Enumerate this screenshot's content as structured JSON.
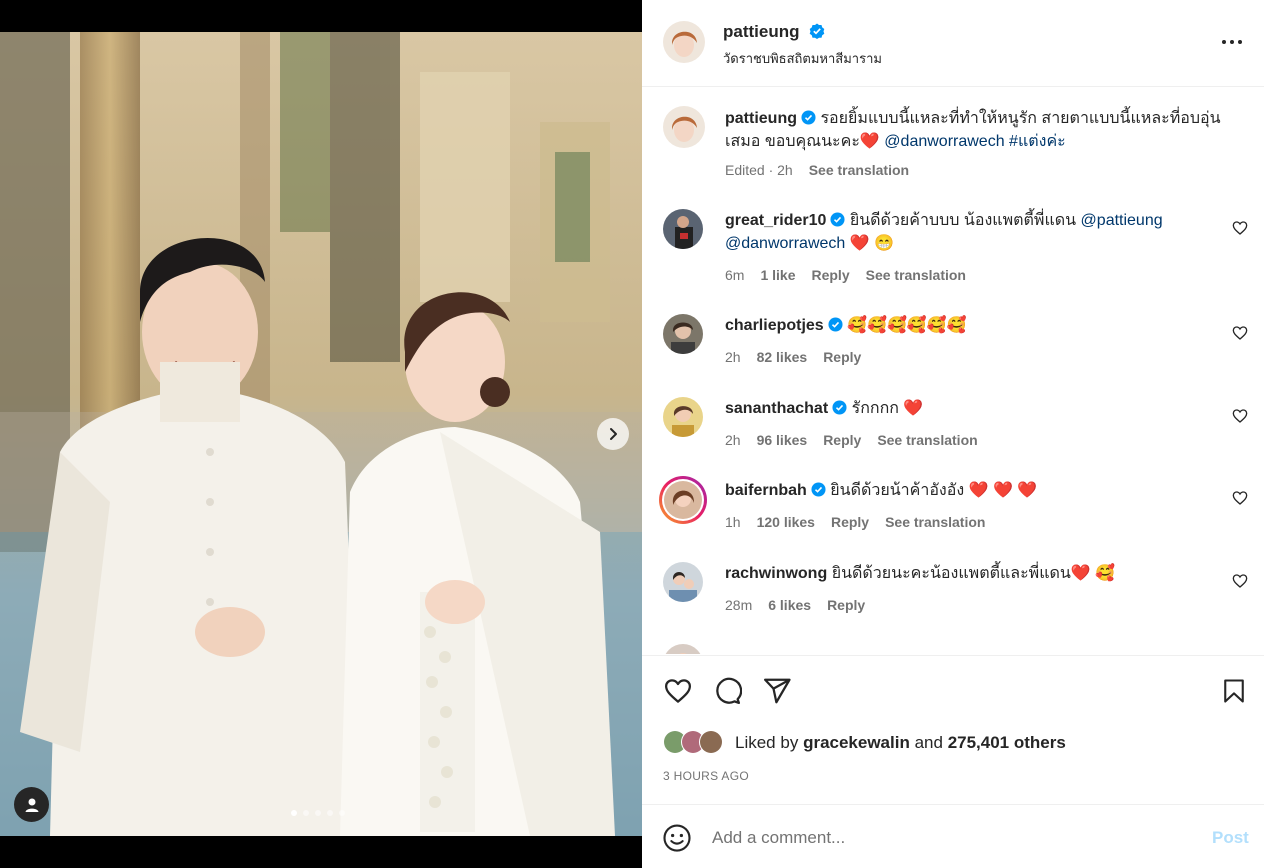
{
  "post": {
    "username": "pattieung",
    "location": "วัดราชบพิธสถิตมหาสีมาราม",
    "caption_text": "รอยยิ้มแบบนี้แหละที่ทำให้หนูรัก สายตาแบบนี้แหละที่อบอุ่นเสมอ ขอบคุณนะคะ❤️",
    "caption_mention": "@danworrawech",
    "caption_hashtag": "#แต่งค่ะ",
    "caption_meta": "Edited · 2h",
    "see_translation": "See translation"
  },
  "comments": [
    {
      "username": "great_rider10",
      "verified": true,
      "text": "ยินดีด้วยค้าบบบ น้องแพตตี้พี่แดน",
      "mentions": "@pattieung @danworrawech",
      "emoji": "❤️ 😁",
      "time": "6m",
      "likes": "1 like",
      "reply": "Reply",
      "translate": "See translation"
    },
    {
      "username": "charliepotjes",
      "verified": true,
      "text": "",
      "emoji": "🥰🥰🥰🥰🥰🥰",
      "time": "2h",
      "likes": "82 likes",
      "reply": "Reply"
    },
    {
      "username": "sananthachat",
      "verified": true,
      "text": "รักกกก",
      "emoji": "❤️",
      "time": "2h",
      "likes": "96 likes",
      "reply": "Reply",
      "translate": "See translation"
    },
    {
      "username": "baifernbah",
      "verified": true,
      "text": "ยินดีด้วยน้าค้าอังอัง",
      "emoji": "❤️ ❤️ ❤️",
      "time": "1h",
      "likes": "120 likes",
      "reply": "Reply",
      "translate": "See translation"
    },
    {
      "username": "rachwinwong",
      "verified": false,
      "text": "ยินดีด้วยนะคะน้องแพตตี้และพี่แดน",
      "emoji": "❤️ 🥰",
      "time": "28m",
      "likes": "6 likes",
      "reply": "Reply"
    }
  ],
  "likes": {
    "prefix": "Liked by",
    "user": "gracekewalin",
    "and": "and",
    "others": "275,401 others"
  },
  "timestamp": "3 HOURS AGO",
  "comment_box": {
    "placeholder": "Add a comment...",
    "post_label": "Post"
  },
  "colors": {
    "verified": "#0095f6",
    "link": "#00376b",
    "post_disabled": "#b2dffc",
    "heart": "#e8112d"
  },
  "carousel": {
    "slides": 5,
    "active": 1
  }
}
